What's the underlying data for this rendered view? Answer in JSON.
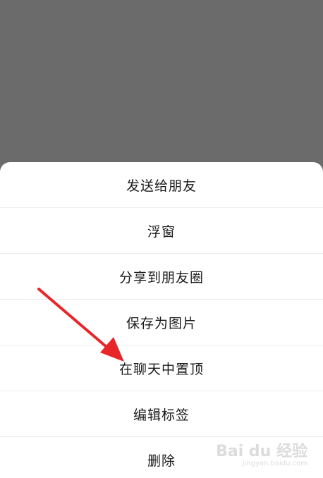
{
  "menu": {
    "items": [
      {
        "label": "发送给朋友"
      },
      {
        "label": "浮窗"
      },
      {
        "label": "分享到朋友圈"
      },
      {
        "label": "保存为图片"
      },
      {
        "label": "在聊天中置顶"
      },
      {
        "label": "编辑标签"
      },
      {
        "label": "删除"
      }
    ]
  },
  "watermark": {
    "logo": "Bai du 经验",
    "url": "jingyan.baidu.com"
  },
  "colors": {
    "overlay": "#6b6b6b",
    "sheet": "#ffffff",
    "arrow": "#e8262a",
    "text": "#1a1a1a"
  }
}
